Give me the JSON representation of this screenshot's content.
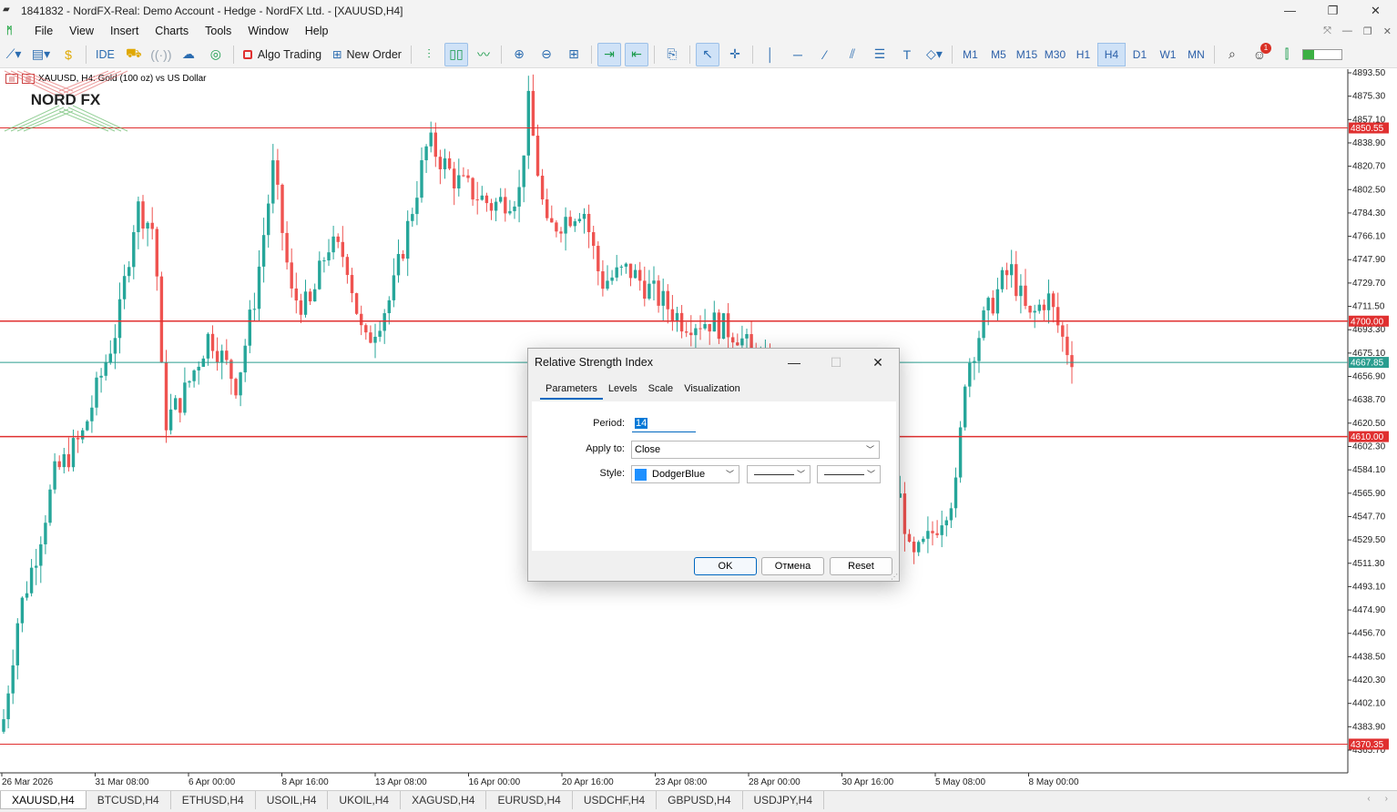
{
  "window": {
    "title": "1841832 - NordFX-Real: Demo Account - Hedge - NordFX Ltd. - [XAUUSD,H4]",
    "controls": [
      "—",
      "❐",
      "✕"
    ]
  },
  "menu": [
    "File",
    "View",
    "Insert",
    "Charts",
    "Tools",
    "Window",
    "Help"
  ],
  "toolbar": {
    "ide_label": "IDE",
    "algo_trading_label": "Algo Trading",
    "new_order_label": "New Order",
    "timeframes": [
      "M1",
      "M5",
      "M15",
      "M30",
      "H1",
      "H4",
      "D1",
      "W1",
      "MN"
    ],
    "active_timeframe": "H4",
    "notification_count": "1"
  },
  "chart": {
    "label": "XAUUSD, H4:  Gold (100 oz) vs US Dollar",
    "price_ticks": [
      "4893.50",
      "4875.30",
      "4857.10",
      "4838.90",
      "4820.70",
      "4802.50",
      "4784.30",
      "4766.10",
      "4747.90",
      "4729.70",
      "4711.50",
      "4693.30",
      "4675.10",
      "4656.90",
      "4638.70",
      "4620.50",
      "4602.30",
      "4584.10",
      "4565.90",
      "4547.70",
      "4529.50",
      "4511.30",
      "4493.10",
      "4474.90",
      "4456.70",
      "4438.50",
      "4420.30",
      "4402.10",
      "4383.90",
      "4365.70"
    ],
    "time_ticks": [
      "26 Mar 2026",
      "31 Mar 08:00",
      "6 Apr 00:00",
      "8 Apr 16:00",
      "13 Apr 08:00",
      "16 Apr 00:00",
      "20 Apr 16:00",
      "23 Apr 08:00",
      "28 Apr 00:00",
      "30 Apr 16:00",
      "5 May 08:00",
      "8 May 00:00"
    ],
    "price_labels": [
      {
        "value": "4850.55",
        "color": "#e03030"
      },
      {
        "value": "4700.00",
        "color": "#e03030"
      },
      {
        "value": "4667.85",
        "color": "#2a9d8f"
      },
      {
        "value": "4610.00",
        "color": "#e03030"
      },
      {
        "value": "4370.35",
        "color": "#e03030"
      }
    ],
    "bull_color": "#26a69a",
    "bear_color": "#ef5350",
    "logo_text": "NORD FX"
  },
  "dialog": {
    "title": "Relative Strength Index",
    "tabs": [
      "Parameters",
      "Levels",
      "Scale",
      "Visualization"
    ],
    "active_tab": "Parameters",
    "period_label": "Period:",
    "period_value": "14",
    "apply_label": "Apply to:",
    "apply_value": "Close",
    "style_label": "Style:",
    "style_color_name": "DodgerBlue",
    "style_color": "#1e90ff",
    "ok_label": "OK",
    "cancel_label": "Отмена",
    "reset_label": "Reset"
  },
  "symbol_tabs": [
    "XAUUSD,H4",
    "BTCUSD,H4",
    "ETHUSD,H4",
    "USOIL,H4",
    "UKOIL,H4",
    "XAGUSD,H4",
    "EURUSD,H4",
    "USDCHF,H4",
    "GBPUSD,H4",
    "USDJPY,H4"
  ],
  "active_symbol_tab": "XAUUSD,H4"
}
